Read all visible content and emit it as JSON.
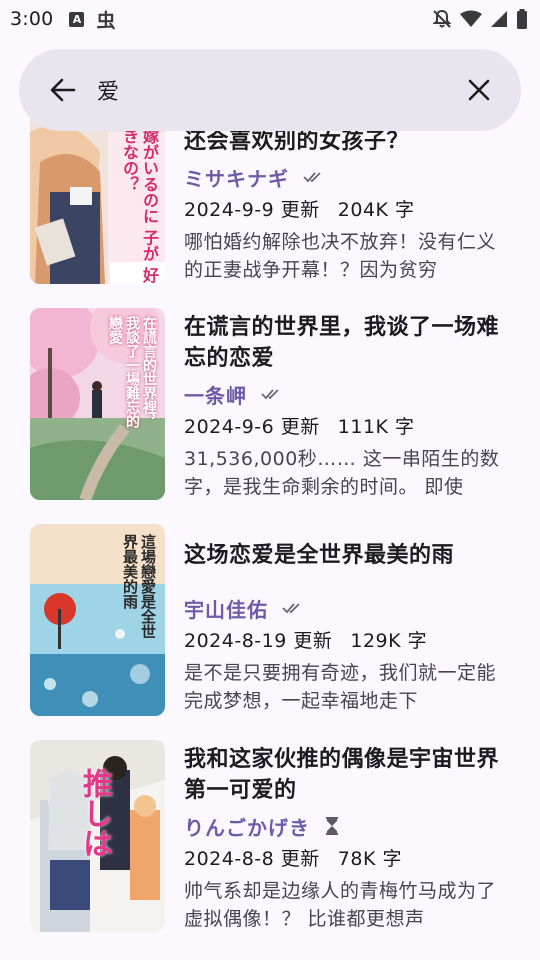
{
  "status_bar": {
    "time": "3:00",
    "a_badge": "A",
    "bug_glyph": "虫"
  },
  "search": {
    "query": "爱"
  },
  "books": [
    {
      "title": "还会喜欢别的女孩子？",
      "author": "ミサキナギ",
      "status_icon": "double-check-icon",
      "date": "2024-9-9 更新",
      "words": "204K 字",
      "description": "哪怕婚约解除也决不放弃！没有仁义的正妻战争开幕！？因为贫穷",
      "cover_text": "嫁がいるのに 子が 好きなの？"
    },
    {
      "title": "在谎言的世界里，我谈了一场难忘的恋爱",
      "author": "一条岬",
      "status_icon": "double-check-icon",
      "date": "2024-9-6 更新",
      "words": "111K 字",
      "description": "31,536,000秒…… 这一串陌生的数字，是我生命剩余的时间。 即使",
      "cover_text": "在謊言的世界裡，我談了一場難忘的戀愛"
    },
    {
      "title": "这场恋爱是全世界最美的雨",
      "author": "宇山佳佑",
      "status_icon": "double-check-icon",
      "date": "2024-8-19 更新",
      "words": "129K 字",
      "description": "是不是只要拥有奇迹，我们就一定能完成梦想，一起幸福地走下",
      "cover_text": "這場戀愛是全世界最美的雨"
    },
    {
      "title": "我和这家伙推的偶像是宇宙世界第一可爱的",
      "author": "りんごかげき",
      "status_icon": "hourglass-icon",
      "date": "2024-8-8 更新",
      "words": "78K 字",
      "description": "帅气系却是边缘人的青梅竹马成为了虚拟偶像！？ 比谁都更想声",
      "cover_text": "推しは"
    }
  ]
}
